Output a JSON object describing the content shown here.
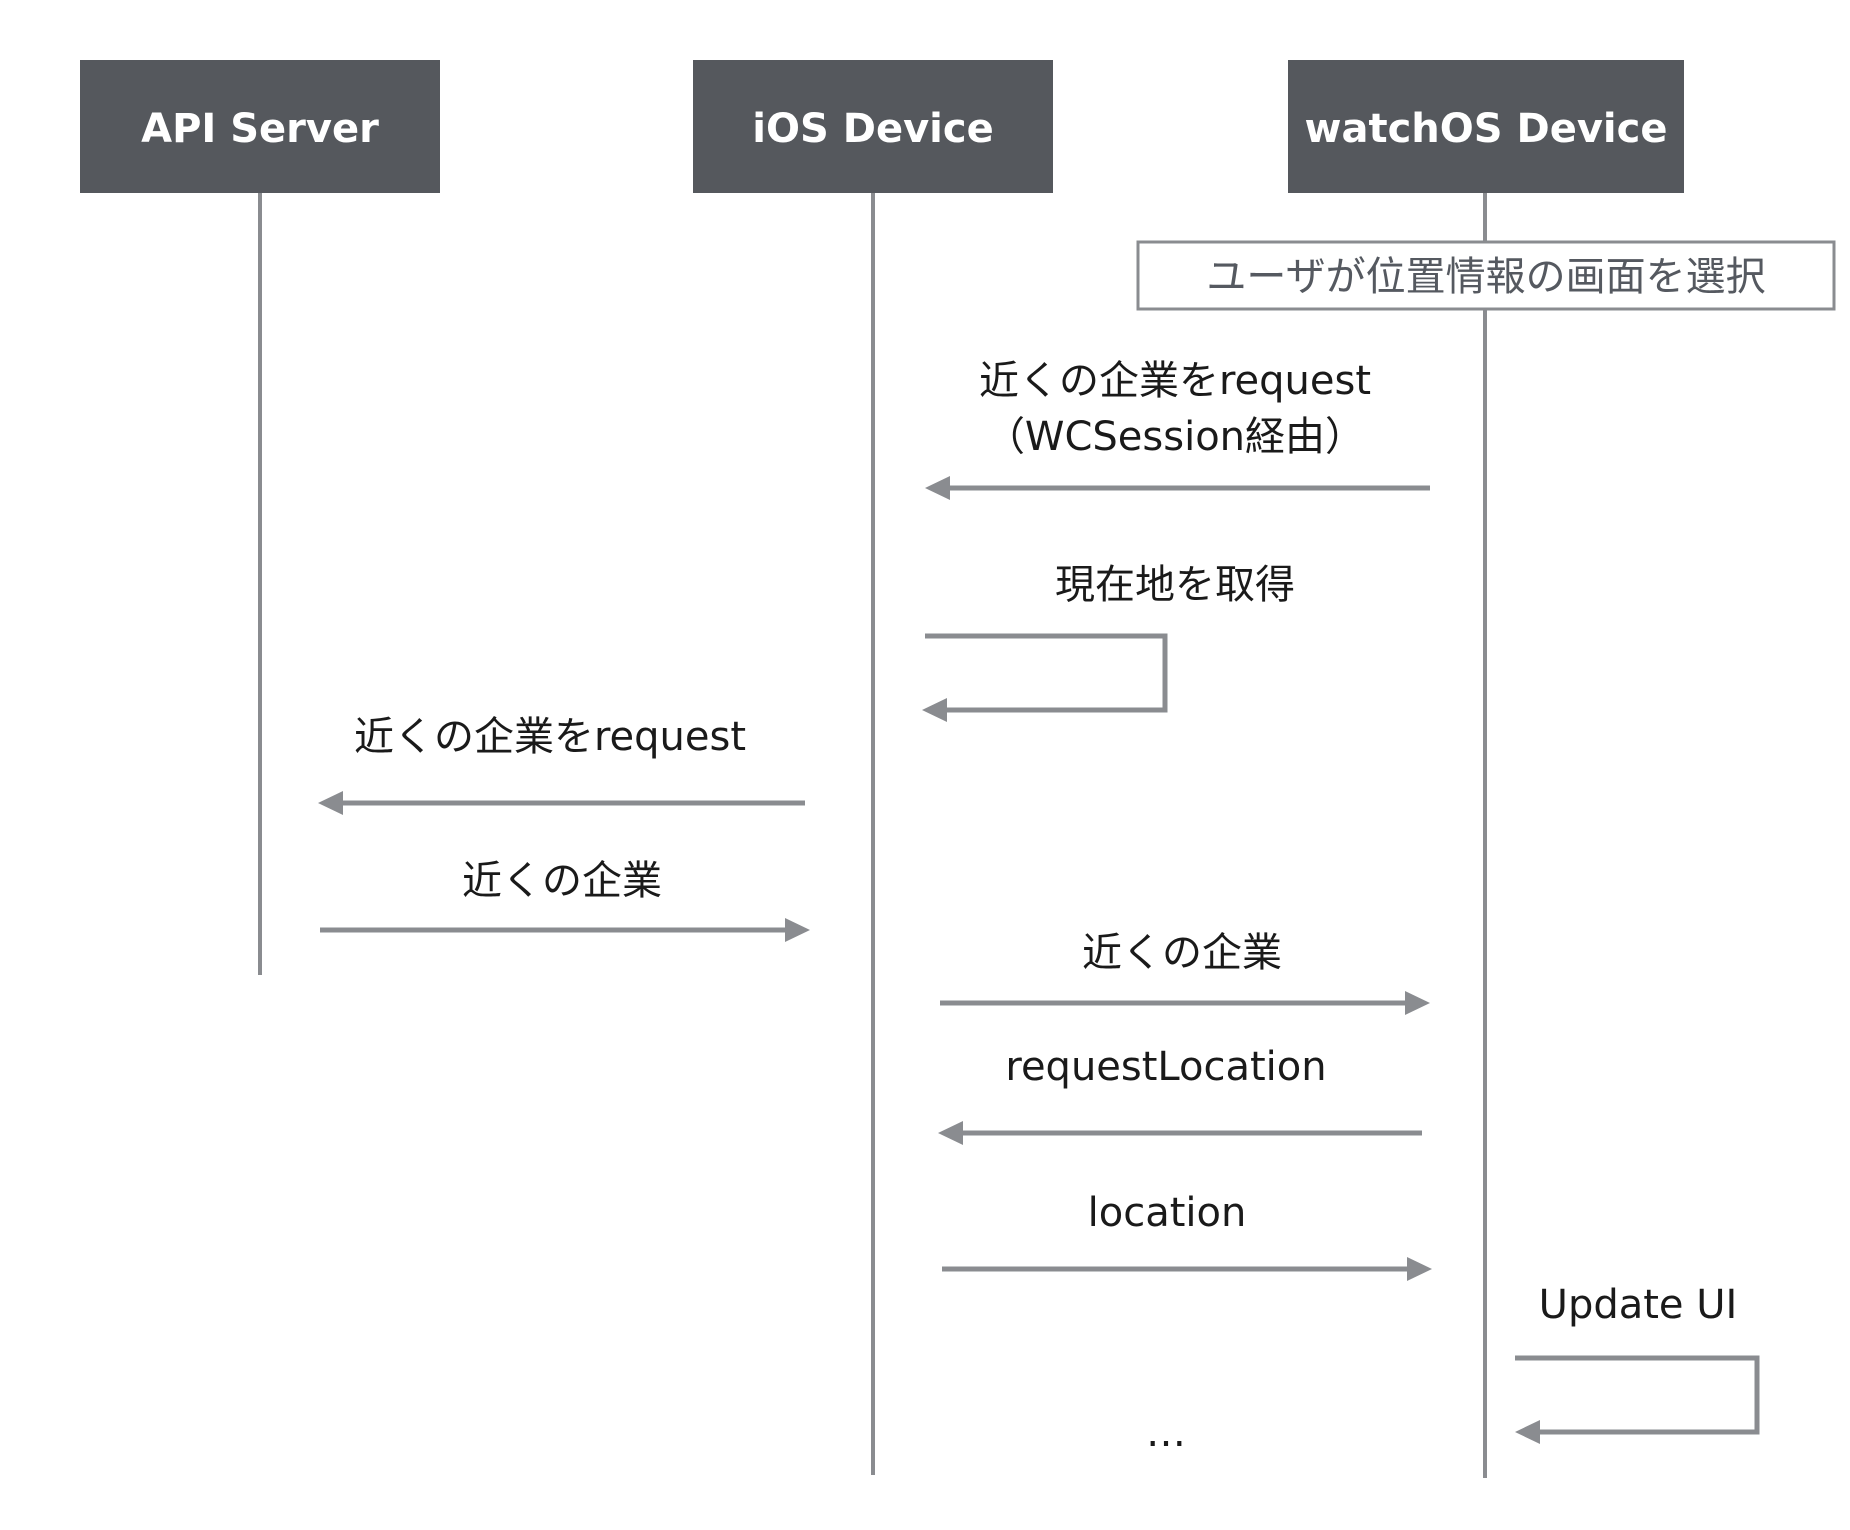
{
  "participants": [
    {
      "label": "API Server"
    },
    {
      "label": "iOS Device"
    },
    {
      "label": "watchOS Device"
    }
  ],
  "note": "ユーザが位置情報の画面を選択",
  "messages": [
    {
      "line1": "近くの企業をrequest",
      "line2": "（WCSession経由）",
      "from": "watchOS Device",
      "to": "iOS Device"
    },
    {
      "line1": "現在地を取得",
      "from": "iOS Device",
      "to": "iOS Device"
    },
    {
      "line1": "近くの企業をrequest",
      "from": "iOS Device",
      "to": "API Server"
    },
    {
      "line1": "近くの企業",
      "from": "API Server",
      "to": "iOS Device"
    },
    {
      "line1": "近くの企業",
      "from": "iOS Device",
      "to": "watchOS Device"
    },
    {
      "line1": "requestLocation",
      "from": "watchOS Device",
      "to": "iOS Device"
    },
    {
      "line1": "location",
      "from": "iOS Device",
      "to": "watchOS Device"
    },
    {
      "line1": "Update UI",
      "from": "watchOS Device",
      "to": "watchOS Device"
    }
  ],
  "ellipsis": "…",
  "colors": {
    "header_bg": "#55585d",
    "lifeline": "#8a8c90",
    "arrow": "#8a8c90",
    "note_border": "#8a8c90",
    "text": "#1a1a1a"
  }
}
